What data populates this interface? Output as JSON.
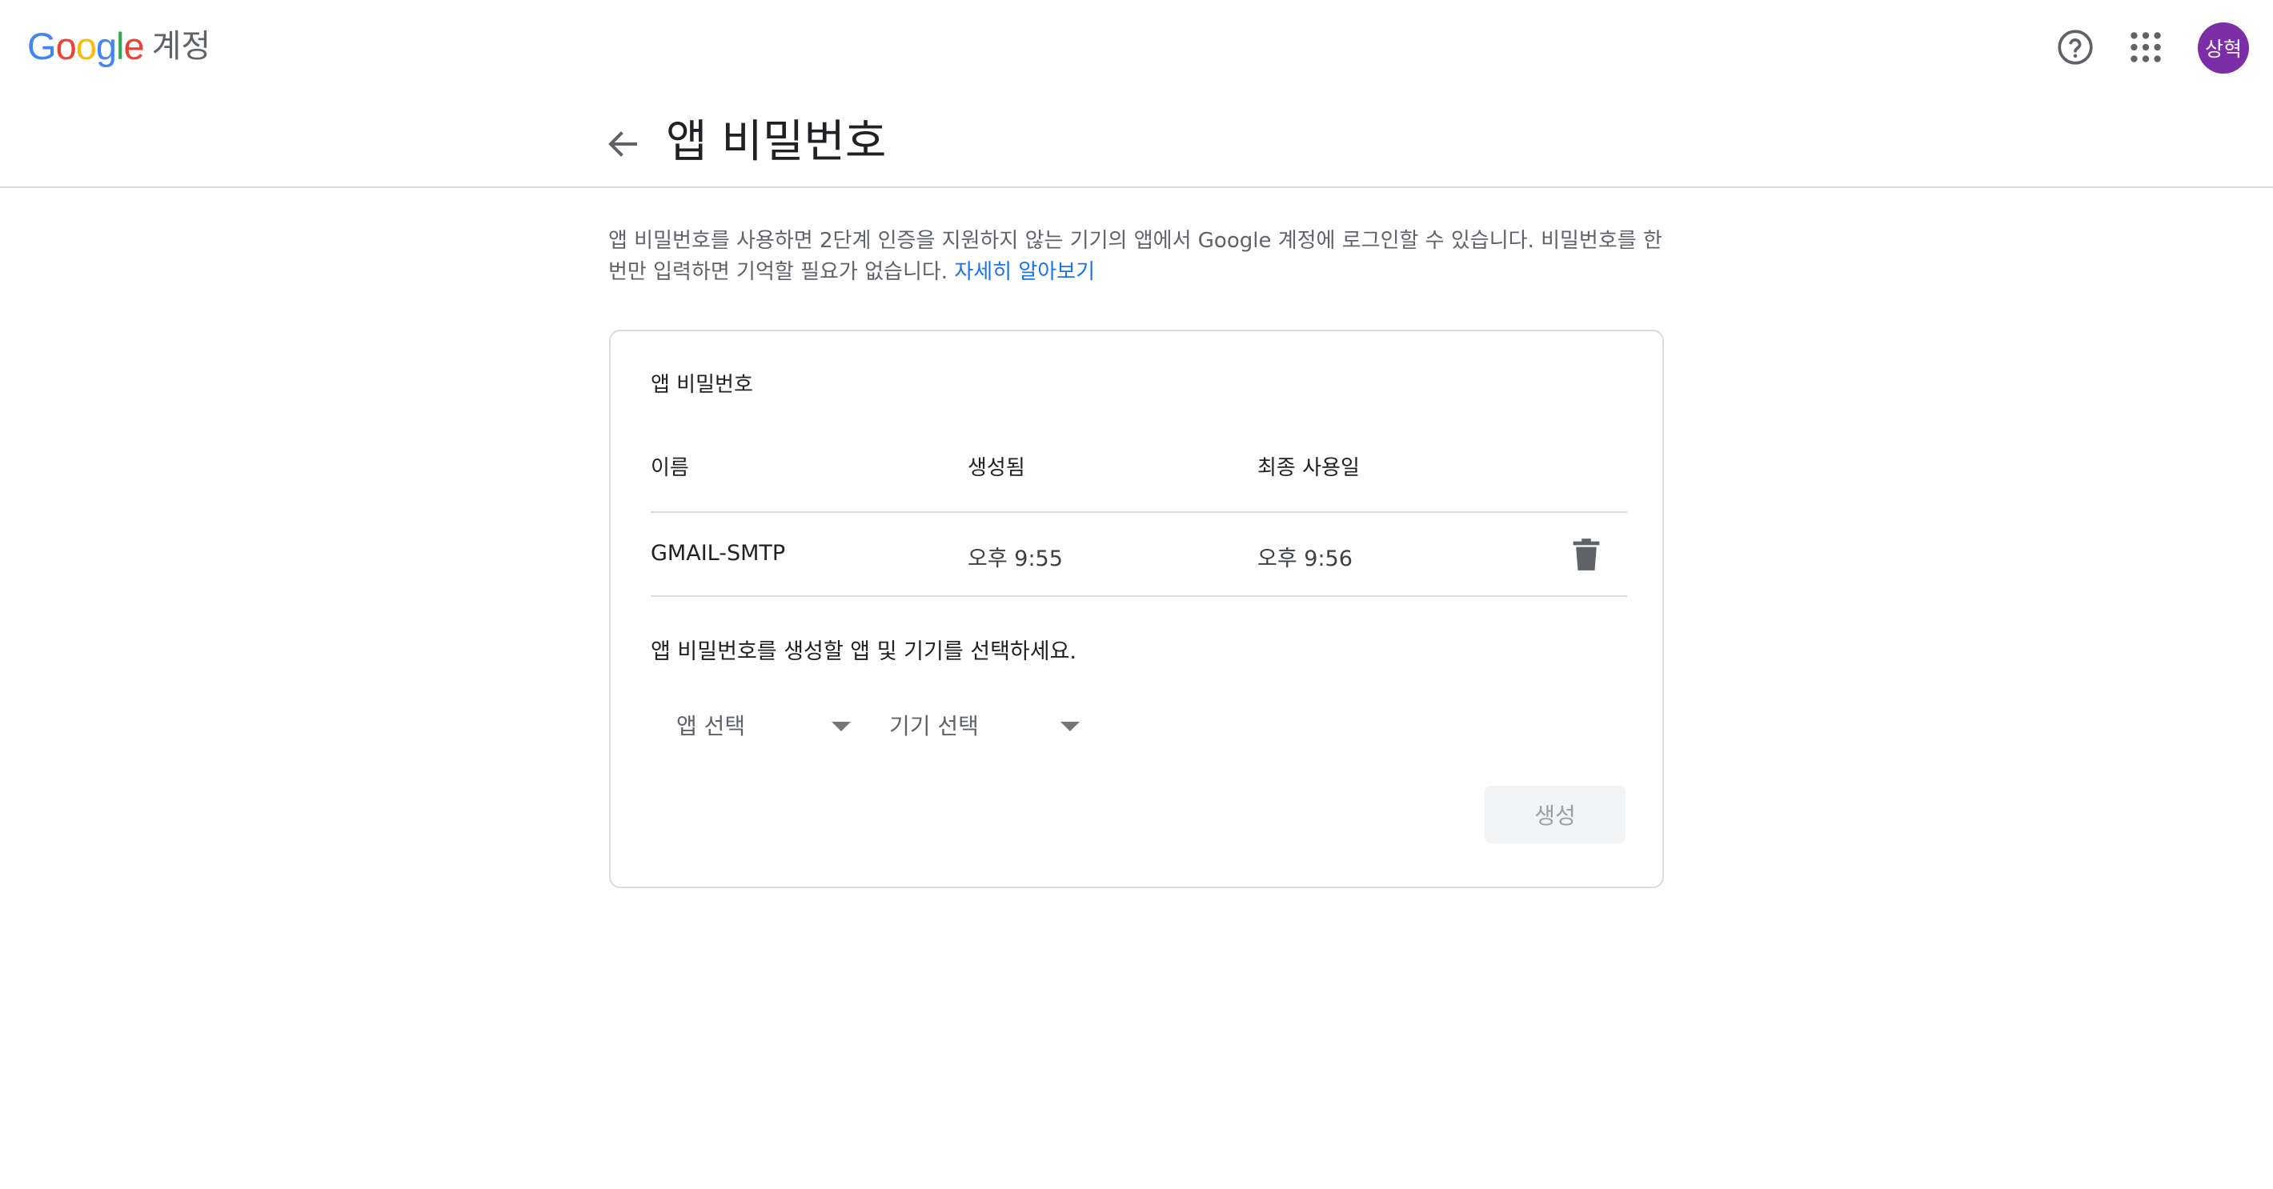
{
  "header": {
    "logo_letters": [
      "G",
      "o",
      "o",
      "g",
      "l",
      "e"
    ],
    "product": "계정",
    "help_icon": "help-circle-icon",
    "apps_icon": "apps-grid-icon",
    "avatar_text": "상혁",
    "avatar_color": "#7b2ea5"
  },
  "page": {
    "back_icon": "arrow-back-icon",
    "title": "앱 비밀번호"
  },
  "intro": {
    "text": "앱 비밀번호를 사용하면 2단계 인증을 지원하지 않는 기기의 앱에서 Google 계정에 로그인할 수 있습니다. 비밀번호를 한 번만 입력하면 기억할 필요가 없습니다.",
    "link": "자세히 알아보기",
    "link_color": "#1a73e8"
  },
  "card": {
    "title": "앱 비밀번호",
    "columns": [
      "이름",
      "생성됨",
      "최종 사용일"
    ],
    "rows": [
      {
        "name": "GMAIL-SMTP",
        "created": "오후 9:55",
        "last_used": "오후 9:56",
        "action_icon": "trash-icon"
      }
    ],
    "instruction": "앱 비밀번호를 생성할 앱 및 기기를 선택하세요.",
    "app_select": "앱 선택",
    "device_select": "기기 선택",
    "generate_button": "생성"
  }
}
